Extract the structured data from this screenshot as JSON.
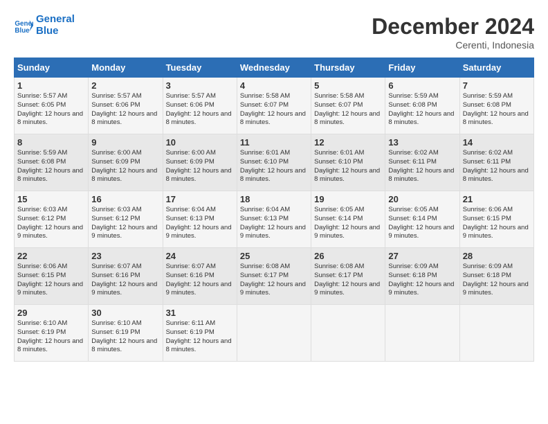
{
  "logo": {
    "general": "General",
    "blue": "Blue"
  },
  "title": "December 2024",
  "subtitle": "Cerenti, Indonesia",
  "days_of_week": [
    "Sunday",
    "Monday",
    "Tuesday",
    "Wednesday",
    "Thursday",
    "Friday",
    "Saturday"
  ],
  "weeks": [
    [
      {
        "day": "1",
        "sunrise": "5:57 AM",
        "sunset": "6:05 PM",
        "daylight": "12 hours and 8 minutes."
      },
      {
        "day": "2",
        "sunrise": "5:57 AM",
        "sunset": "6:06 PM",
        "daylight": "12 hours and 8 minutes."
      },
      {
        "day": "3",
        "sunrise": "5:57 AM",
        "sunset": "6:06 PM",
        "daylight": "12 hours and 8 minutes."
      },
      {
        "day": "4",
        "sunrise": "5:58 AM",
        "sunset": "6:07 PM",
        "daylight": "12 hours and 8 minutes."
      },
      {
        "day": "5",
        "sunrise": "5:58 AM",
        "sunset": "6:07 PM",
        "daylight": "12 hours and 8 minutes."
      },
      {
        "day": "6",
        "sunrise": "5:59 AM",
        "sunset": "6:08 PM",
        "daylight": "12 hours and 8 minutes."
      },
      {
        "day": "7",
        "sunrise": "5:59 AM",
        "sunset": "6:08 PM",
        "daylight": "12 hours and 8 minutes."
      }
    ],
    [
      {
        "day": "8",
        "sunrise": "5:59 AM",
        "sunset": "6:08 PM",
        "daylight": "12 hours and 8 minutes."
      },
      {
        "day": "9",
        "sunrise": "6:00 AM",
        "sunset": "6:09 PM",
        "daylight": "12 hours and 8 minutes."
      },
      {
        "day": "10",
        "sunrise": "6:00 AM",
        "sunset": "6:09 PM",
        "daylight": "12 hours and 8 minutes."
      },
      {
        "day": "11",
        "sunrise": "6:01 AM",
        "sunset": "6:10 PM",
        "daylight": "12 hours and 8 minutes."
      },
      {
        "day": "12",
        "sunrise": "6:01 AM",
        "sunset": "6:10 PM",
        "daylight": "12 hours and 8 minutes."
      },
      {
        "day": "13",
        "sunrise": "6:02 AM",
        "sunset": "6:11 PM",
        "daylight": "12 hours and 8 minutes."
      },
      {
        "day": "14",
        "sunrise": "6:02 AM",
        "sunset": "6:11 PM",
        "daylight": "12 hours and 8 minutes."
      }
    ],
    [
      {
        "day": "15",
        "sunrise": "6:03 AM",
        "sunset": "6:12 PM",
        "daylight": "12 hours and 9 minutes."
      },
      {
        "day": "16",
        "sunrise": "6:03 AM",
        "sunset": "6:12 PM",
        "daylight": "12 hours and 9 minutes."
      },
      {
        "day": "17",
        "sunrise": "6:04 AM",
        "sunset": "6:13 PM",
        "daylight": "12 hours and 9 minutes."
      },
      {
        "day": "18",
        "sunrise": "6:04 AM",
        "sunset": "6:13 PM",
        "daylight": "12 hours and 9 minutes."
      },
      {
        "day": "19",
        "sunrise": "6:05 AM",
        "sunset": "6:14 PM",
        "daylight": "12 hours and 9 minutes."
      },
      {
        "day": "20",
        "sunrise": "6:05 AM",
        "sunset": "6:14 PM",
        "daylight": "12 hours and 9 minutes."
      },
      {
        "day": "21",
        "sunrise": "6:06 AM",
        "sunset": "6:15 PM",
        "daylight": "12 hours and 9 minutes."
      }
    ],
    [
      {
        "day": "22",
        "sunrise": "6:06 AM",
        "sunset": "6:15 PM",
        "daylight": "12 hours and 9 minutes."
      },
      {
        "day": "23",
        "sunrise": "6:07 AM",
        "sunset": "6:16 PM",
        "daylight": "12 hours and 9 minutes."
      },
      {
        "day": "24",
        "sunrise": "6:07 AM",
        "sunset": "6:16 PM",
        "daylight": "12 hours and 9 minutes."
      },
      {
        "day": "25",
        "sunrise": "6:08 AM",
        "sunset": "6:17 PM",
        "daylight": "12 hours and 9 minutes."
      },
      {
        "day": "26",
        "sunrise": "6:08 AM",
        "sunset": "6:17 PM",
        "daylight": "12 hours and 9 minutes."
      },
      {
        "day": "27",
        "sunrise": "6:09 AM",
        "sunset": "6:18 PM",
        "daylight": "12 hours and 9 minutes."
      },
      {
        "day": "28",
        "sunrise": "6:09 AM",
        "sunset": "6:18 PM",
        "daylight": "12 hours and 9 minutes."
      }
    ],
    [
      {
        "day": "29",
        "sunrise": "6:10 AM",
        "sunset": "6:19 PM",
        "daylight": "12 hours and 8 minutes."
      },
      {
        "day": "30",
        "sunrise": "6:10 AM",
        "sunset": "6:19 PM",
        "daylight": "12 hours and 8 minutes."
      },
      {
        "day": "31",
        "sunrise": "6:11 AM",
        "sunset": "6:19 PM",
        "daylight": "12 hours and 8 minutes."
      },
      null,
      null,
      null,
      null
    ]
  ]
}
